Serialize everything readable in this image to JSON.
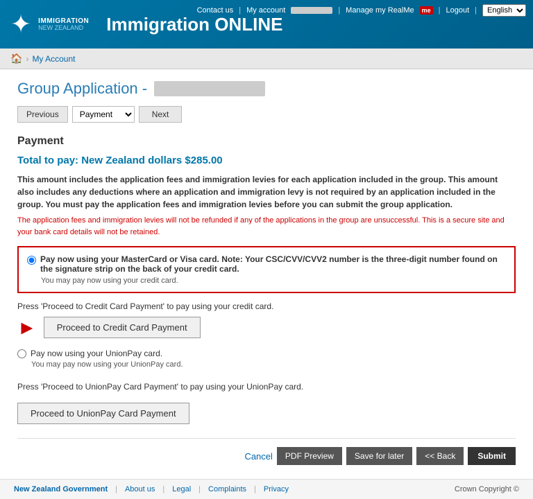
{
  "header": {
    "logo_immigration": "IMMIGRATION",
    "logo_nz": "NEW ZEALAND",
    "title": "Immigration ONLINE",
    "nav": {
      "contact": "Contact us",
      "my_account": "My account",
      "manage": "Manage my RealMe",
      "logout": "Logout",
      "language": "English"
    }
  },
  "breadcrumb": {
    "home_icon": "🏠",
    "link": "My Account"
  },
  "page": {
    "title": "Group Application -",
    "title_id_placeholder": "",
    "wizard": {
      "previous_label": "Previous",
      "dropdown_options": [
        "Payment"
      ],
      "dropdown_selected": "Payment",
      "next_label": "Next"
    },
    "section_heading": "Payment",
    "total_label": "Total to pay: New Zealand dollars $285.00",
    "desc_bold": "This amount includes the application fees and immigration levies for each application included in the group. This amount also includes any deductions where an application and immigration levy is not required by an application included in the group. You must pay the application fees and immigration levies before you can submit the group application.",
    "desc_refund": "The application fees and immigration levies will not be refunded if any of the applications in the group are unsuccessful. This is a secure site and your bank card details will not be retained.",
    "creditcard": {
      "option_label": "Pay now using your MasterCard or Visa card. Note: Your CSC/CVV/CVV2 number is the three-digit number found on the signature strip on the back of your credit card.",
      "option_sub": "You may pay now using your credit card.",
      "hint": "Press 'Proceed to Credit Card Payment' to pay using your credit card.",
      "button": "Proceed to Credit Card Payment"
    },
    "unionpay": {
      "option_label": "Pay now using your UnionPay card.",
      "option_sub": "You may pay now using your UnionPay card.",
      "hint": "Press 'Proceed to UnionPay Card Payment' to pay using your UnionPay card.",
      "button": "Proceed to UnionPay Card Payment"
    },
    "footer_actions": {
      "cancel": "Cancel",
      "pdf_preview": "PDF Preview",
      "save_for_later": "Save for later",
      "back": "<< Back",
      "submit": "Submit"
    }
  },
  "site_footer": {
    "gov": "New Zealand",
    "gov2": "Government",
    "about": "About us",
    "legal": "Legal",
    "complaints": "Complaints",
    "privacy": "Privacy",
    "copyright": "Crown Copyright ©"
  }
}
